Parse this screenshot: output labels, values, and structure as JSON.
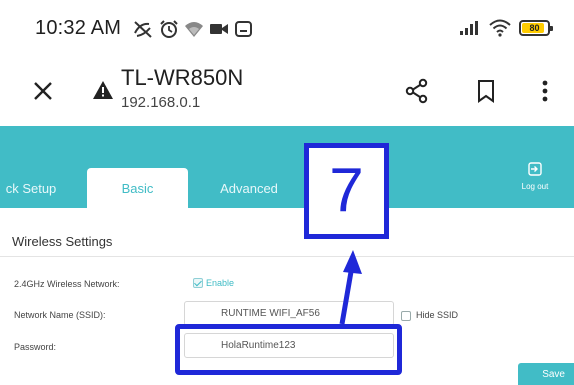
{
  "status_bar": {
    "time": "10:32 AM",
    "battery": "80"
  },
  "browser": {
    "site_title": "TL-WR850N",
    "site_url": "192.168.0.1"
  },
  "tabs": [
    {
      "label": "ck Setup",
      "active": false
    },
    {
      "label": "Basic",
      "active": true
    },
    {
      "label": "Advanced",
      "active": false
    }
  ],
  "logout_label": "Log out",
  "section_title": "Wireless Settings",
  "wireless": {
    "network_label": "2.4GHz Wireless Network:",
    "enable_label": "Enable",
    "enable_checked": true,
    "ssid_label": "Network Name (SSID):",
    "ssid_value": "RUNTIME WIFI_AF56",
    "hide_ssid_label": "Hide SSID",
    "hide_ssid_checked": false,
    "password_label": "Password:",
    "password_value": "HolaRuntime123"
  },
  "save_label": "Save",
  "annotation": {
    "number": "7",
    "color": "#1f28d8"
  },
  "colors": {
    "accent": "#41bcc6"
  }
}
